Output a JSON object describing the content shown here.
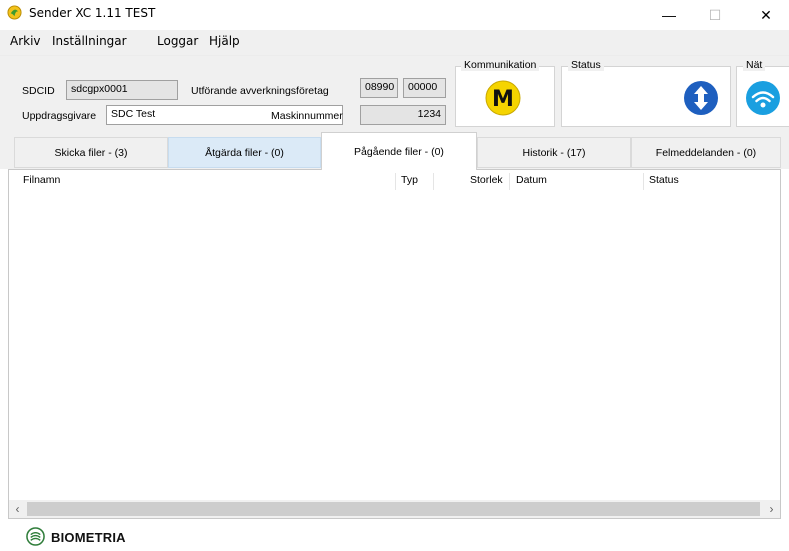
{
  "window": {
    "title": "Sender XC 1.11   TEST",
    "controls": {
      "minimize": "—",
      "maximize": "☐",
      "close": "✕"
    }
  },
  "menu": [
    "Arkiv",
    "Inställningar",
    "Loggar",
    "Hjälp"
  ],
  "header": {
    "sdcid_label": "SDCID",
    "sdcid_value": "sdcgpx0001",
    "uppdragsgivare_label": "Uppdragsgivare",
    "uppdragsgivare_value": "SDC Test",
    "foretag_label": "Utförande avverkningsföretag",
    "foretag_value1": "08990",
    "foretag_value2": "00000",
    "maskinnummer_label": "Maskinnummer",
    "maskinnummer_value": "1234",
    "groups": {
      "kommunikation": "Kommunikation",
      "status": "Status",
      "nat": "Nät"
    },
    "kommunikation_letter": "M"
  },
  "tabs": [
    {
      "label": "Skicka filer - (3)"
    },
    {
      "label": "Åtgärda filer - (0)"
    },
    {
      "label": "Pågående filer - (0)"
    },
    {
      "label": "Historik - (17)"
    },
    {
      "label": "Felmeddelanden - (0)"
    }
  ],
  "list": {
    "columns": [
      "Filnamn",
      "Typ",
      "Storlek",
      "Datum",
      "Status"
    ],
    "rows": []
  },
  "footer": {
    "brand": "BIOMETRIA"
  },
  "colors": {
    "kommunikation_badge": "#f5d400",
    "status_icon": "#1e5fbf",
    "nat_icon": "#1a9fe0",
    "tab_highlight": "#dbeaf7"
  },
  "icons": [
    "app-icon",
    "m-badge-icon",
    "up-down-arrow-icon",
    "wifi-icon",
    "biometria-logo-icon",
    "chevron-left-icon",
    "chevron-right-icon"
  ]
}
